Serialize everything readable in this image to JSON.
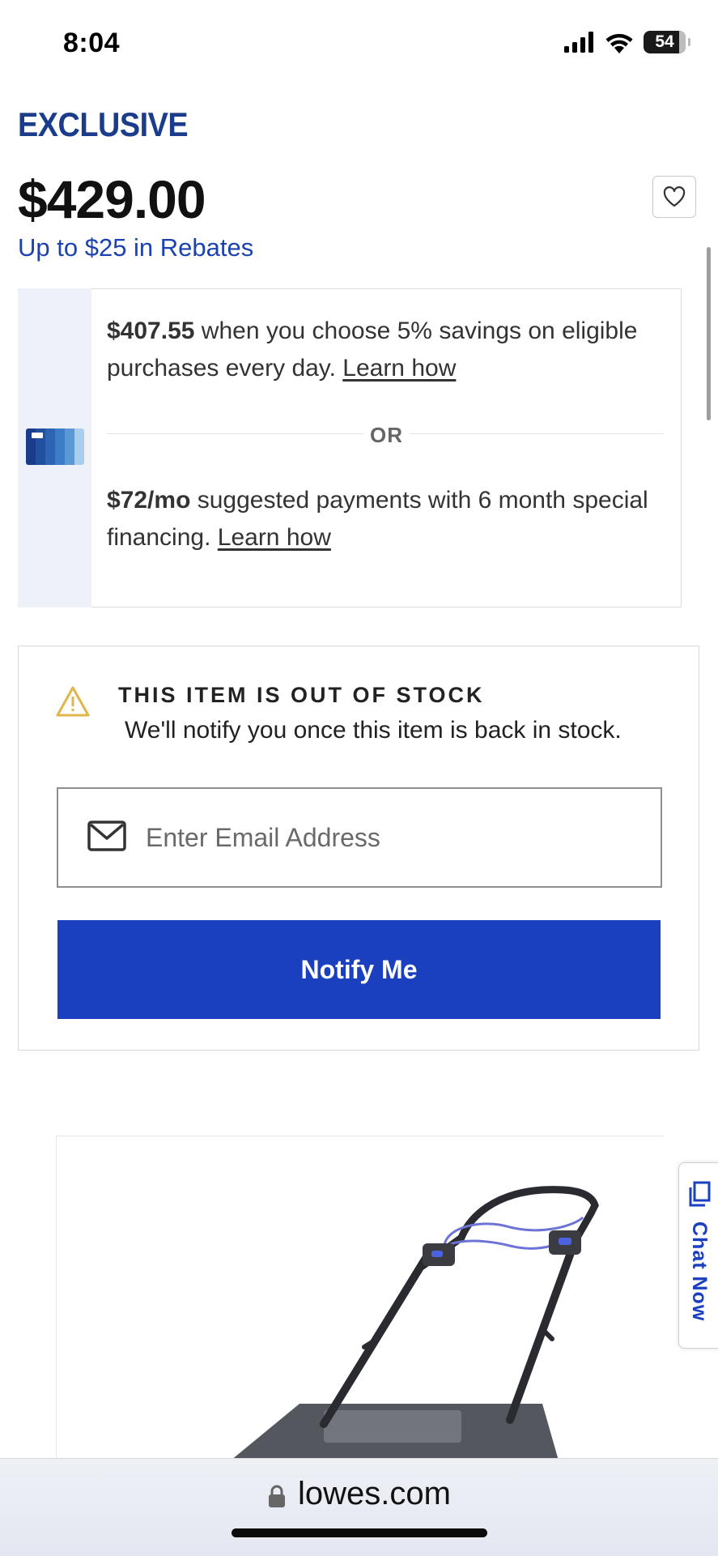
{
  "status_bar": {
    "time": "8:04",
    "battery": "54",
    "icons": [
      "cellular-signal-icon",
      "wifi-icon",
      "battery-icon"
    ]
  },
  "product": {
    "badge": "EXCLUSIVE",
    "price": "$429.00",
    "rebates_link": "Up to $25 in Rebates"
  },
  "financing": {
    "savings_amount": "$407.55",
    "savings_text": " when you choose 5% savings on eligible purchases every day. ",
    "savings_link": "Learn how",
    "divider_label": "OR",
    "payment_amount": "$72/mo",
    "payment_text": " suggested payments with 6 month special financing. ",
    "payment_link": "Learn how"
  },
  "stock_notice": {
    "title": "THIS ITEM IS OUT OF STOCK",
    "subtitle": "We'll notify you once this item is back in stock.",
    "email_placeholder": "Enter Email Address",
    "email_value": "",
    "notify_button": "Notify Me"
  },
  "chat": {
    "label": "Chat Now"
  },
  "browser": {
    "url": "lowes.com"
  },
  "colors": {
    "brand_blue": "#1a3fbf",
    "exclusive_blue": "#1a3c8b",
    "link_blue": "#1b42b0",
    "warning_yellow": "#e0b54a"
  }
}
